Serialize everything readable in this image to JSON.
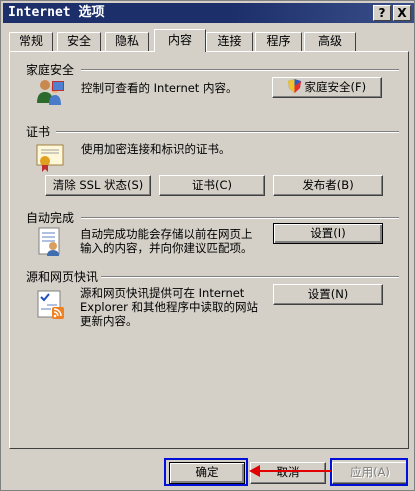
{
  "window": {
    "title": "Internet 选项",
    "help_label": "?",
    "close_label": "X"
  },
  "tabs": [
    {
      "label": "常规"
    },
    {
      "label": "安全"
    },
    {
      "label": "隐私"
    },
    {
      "label": "内容",
      "active": true
    },
    {
      "label": "连接"
    },
    {
      "label": "程序"
    },
    {
      "label": "高级"
    }
  ],
  "family_safety": {
    "heading": "家庭安全",
    "description": "控制可查看的 Internet 内容。",
    "button_label": "家庭安全(F)",
    "icon": "family-safety-icon"
  },
  "certificates": {
    "heading": "证书",
    "description": "使用加密连接和标识的证书。",
    "clear_ssl_label": "清除 SSL 状态(S)",
    "certificates_label": "证书(C)",
    "publishers_label": "发布者(B)",
    "icon": "certificate-icon"
  },
  "autocomplete": {
    "heading": "自动完成",
    "description_line1": "自动完成功能会存储以前在网页上",
    "description_line2": "输入的内容，并向你建议匹配项。",
    "settings_label": "设置(I)",
    "icon": "autocomplete-icon"
  },
  "feeds": {
    "heading": "源和网页快讯",
    "description_line1": "源和网页快讯提供可在 Internet",
    "description_line2": "Explorer 和其他程序中读取的网站",
    "description_line3": "更新内容。",
    "settings_label": "设置(N)",
    "icon": "rss-feed-icon"
  },
  "footer": {
    "ok_label": "确定",
    "cancel_label": "取消",
    "apply_label": "应用(A)"
  },
  "colors": {
    "title_bar": "#1c2f6b",
    "dialog_face": "#d4d0c8",
    "highlight_box": "#0010d8",
    "arrow": "#e00000"
  }
}
